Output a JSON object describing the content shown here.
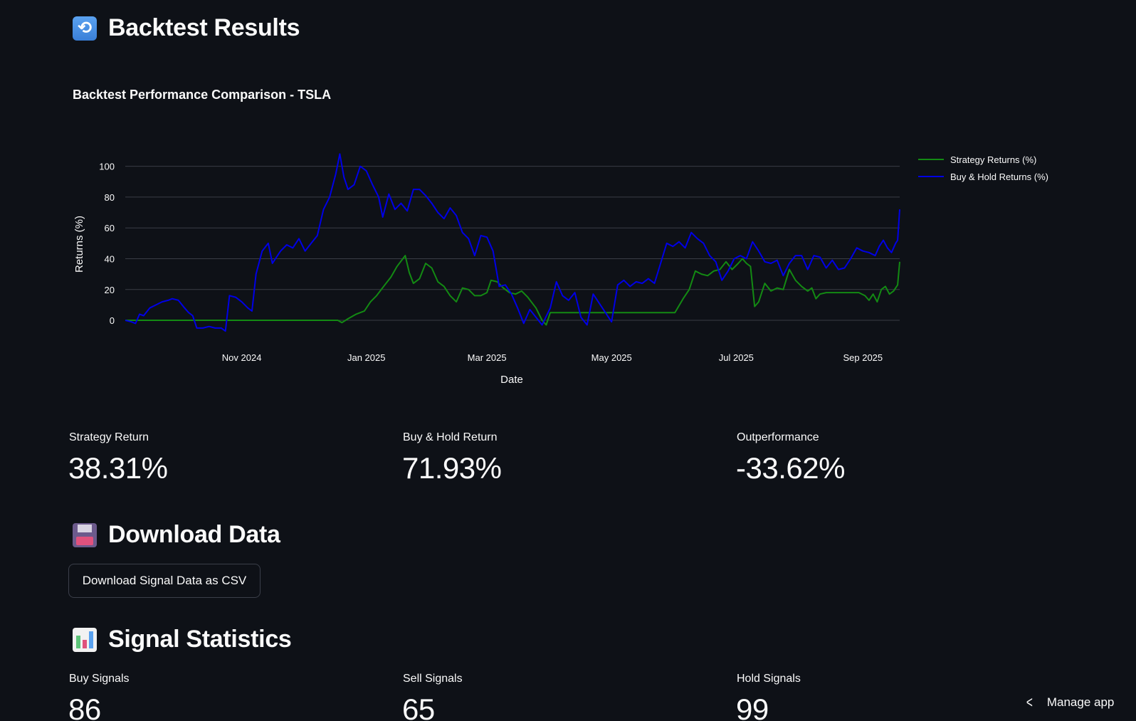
{
  "header": {
    "title": "Backtest Results",
    "icon": "refresh-icon"
  },
  "chart": {
    "title": "Backtest Performance Comparison - TSLA",
    "xlabel": "Date",
    "ylabel": "Returns (%)"
  },
  "chart_data": {
    "type": "line",
    "title": "Backtest Performance Comparison - TSLA",
    "xlabel": "Date",
    "ylabel": "Returns (%)",
    "x_range": [
      "2024-09-05",
      "2025-09-19"
    ],
    "ylim": [
      -12,
      110
    ],
    "y_ticks": [
      0,
      20,
      40,
      60,
      80,
      100
    ],
    "x_ticks": [
      {
        "date": "2024-11-01",
        "label": "Nov 2024"
      },
      {
        "date": "2025-01-01",
        "label": "Jan 2025"
      },
      {
        "date": "2025-03-01",
        "label": "Mar 2025"
      },
      {
        "date": "2025-05-01",
        "label": "May 2025"
      },
      {
        "date": "2025-07-01",
        "label": "Jul 2025"
      },
      {
        "date": "2025-09-01",
        "label": "Sep 2025"
      }
    ],
    "grid": true,
    "legend_position": "top-right",
    "series": [
      {
        "name": "Strategy Returns (%)",
        "color": "#138a13",
        "points": [
          [
            "2024-09-05",
            0
          ],
          [
            "2024-09-20",
            0
          ],
          [
            "2024-10-10",
            0
          ],
          [
            "2024-10-30",
            0
          ],
          [
            "2024-11-20",
            0
          ],
          [
            "2024-12-05",
            0
          ],
          [
            "2024-12-18",
            0
          ],
          [
            "2024-12-20",
            -1.5
          ],
          [
            "2024-12-23",
            1
          ],
          [
            "2024-12-27",
            4
          ],
          [
            "2024-12-31",
            6
          ],
          [
            "2025-01-03",
            12
          ],
          [
            "2025-01-06",
            16
          ],
          [
            "2025-01-10",
            23
          ],
          [
            "2025-01-13",
            28
          ],
          [
            "2025-01-16",
            35
          ],
          [
            "2025-01-20",
            42
          ],
          [
            "2025-01-22",
            31
          ],
          [
            "2025-01-24",
            24
          ],
          [
            "2025-01-27",
            27
          ],
          [
            "2025-01-30",
            37
          ],
          [
            "2025-02-02",
            34
          ],
          [
            "2025-02-05",
            25
          ],
          [
            "2025-02-08",
            22
          ],
          [
            "2025-02-11",
            16
          ],
          [
            "2025-02-14",
            12
          ],
          [
            "2025-02-17",
            21
          ],
          [
            "2025-02-20",
            20
          ],
          [
            "2025-02-23",
            16
          ],
          [
            "2025-02-26",
            16
          ],
          [
            "2025-03-01",
            18
          ],
          [
            "2025-03-03",
            26
          ],
          [
            "2025-03-06",
            25
          ],
          [
            "2025-03-09",
            21
          ],
          [
            "2025-03-12",
            18
          ],
          [
            "2025-03-15",
            17
          ],
          [
            "2025-03-18",
            19
          ],
          [
            "2025-03-21",
            15
          ],
          [
            "2025-03-25",
            8
          ],
          [
            "2025-03-28",
            0
          ],
          [
            "2025-03-30",
            -3
          ],
          [
            "2025-04-01",
            5
          ],
          [
            "2025-04-10",
            5
          ],
          [
            "2025-04-25",
            5
          ],
          [
            "2025-05-10",
            5
          ],
          [
            "2025-05-25",
            5
          ],
          [
            "2025-06-01",
            5
          ],
          [
            "2025-06-05",
            14
          ],
          [
            "2025-06-08",
            20
          ],
          [
            "2025-06-11",
            32
          ],
          [
            "2025-06-14",
            30
          ],
          [
            "2025-06-17",
            29
          ],
          [
            "2025-06-20",
            32
          ],
          [
            "2025-06-23",
            33
          ],
          [
            "2025-06-26",
            38
          ],
          [
            "2025-06-29",
            33
          ],
          [
            "2025-07-02",
            37
          ],
          [
            "2025-07-04",
            40
          ],
          [
            "2025-07-06",
            37
          ],
          [
            "2025-07-08",
            35
          ],
          [
            "2025-07-10",
            9
          ],
          [
            "2025-07-12",
            12
          ],
          [
            "2025-07-15",
            24
          ],
          [
            "2025-07-18",
            19
          ],
          [
            "2025-07-21",
            21
          ],
          [
            "2025-07-24",
            20
          ],
          [
            "2025-07-27",
            33
          ],
          [
            "2025-07-30",
            26
          ],
          [
            "2025-08-02",
            22
          ],
          [
            "2025-08-05",
            19
          ],
          [
            "2025-08-07",
            21
          ],
          [
            "2025-08-09",
            14
          ],
          [
            "2025-08-11",
            17
          ],
          [
            "2025-08-14",
            18
          ],
          [
            "2025-08-20",
            18
          ],
          [
            "2025-08-30",
            18
          ],
          [
            "2025-09-02",
            16
          ],
          [
            "2025-09-04",
            13
          ],
          [
            "2025-09-06",
            17
          ],
          [
            "2025-09-08",
            12
          ],
          [
            "2025-09-10",
            20
          ],
          [
            "2025-09-12",
            22
          ],
          [
            "2025-09-14",
            17
          ],
          [
            "2025-09-16",
            19
          ],
          [
            "2025-09-18",
            23
          ],
          [
            "2025-09-19",
            38
          ]
        ]
      },
      {
        "name": "Buy & Hold Returns (%)",
        "color": "#0000e6",
        "points": [
          [
            "2024-09-05",
            0
          ],
          [
            "2024-09-08",
            -1
          ],
          [
            "2024-09-10",
            -2
          ],
          [
            "2024-09-12",
            4
          ],
          [
            "2024-09-14",
            3
          ],
          [
            "2024-09-17",
            8
          ],
          [
            "2024-09-20",
            10
          ],
          [
            "2024-09-23",
            12
          ],
          [
            "2024-09-26",
            13
          ],
          [
            "2024-09-28",
            14
          ],
          [
            "2024-10-01",
            13
          ],
          [
            "2024-10-04",
            8
          ],
          [
            "2024-10-06",
            5
          ],
          [
            "2024-10-08",
            3
          ],
          [
            "2024-10-10",
            -5
          ],
          [
            "2024-10-13",
            -5
          ],
          [
            "2024-10-16",
            -4
          ],
          [
            "2024-10-19",
            -5
          ],
          [
            "2024-10-22",
            -5
          ],
          [
            "2024-10-24",
            -7
          ],
          [
            "2024-10-26",
            16
          ],
          [
            "2024-10-29",
            15
          ],
          [
            "2024-11-01",
            12
          ],
          [
            "2024-11-04",
            8
          ],
          [
            "2024-11-06",
            6
          ],
          [
            "2024-11-08",
            30
          ],
          [
            "2024-11-11",
            45
          ],
          [
            "2024-11-14",
            50
          ],
          [
            "2024-11-16",
            37
          ],
          [
            "2024-11-18",
            41
          ],
          [
            "2024-11-20",
            45
          ],
          [
            "2024-11-23",
            49
          ],
          [
            "2024-11-26",
            47
          ],
          [
            "2024-11-29",
            53
          ],
          [
            "2024-12-02",
            45
          ],
          [
            "2024-12-05",
            50
          ],
          [
            "2024-12-08",
            55
          ],
          [
            "2024-12-11",
            72
          ],
          [
            "2024-12-14",
            80
          ],
          [
            "2024-12-17",
            95
          ],
          [
            "2024-12-19",
            108
          ],
          [
            "2024-12-21",
            93
          ],
          [
            "2024-12-23",
            85
          ],
          [
            "2024-12-26",
            88
          ],
          [
            "2024-12-29",
            100
          ],
          [
            "2025-01-01",
            97
          ],
          [
            "2025-01-04",
            88
          ],
          [
            "2025-01-07",
            80
          ],
          [
            "2025-01-09",
            67
          ],
          [
            "2025-01-12",
            82
          ],
          [
            "2025-01-15",
            72
          ],
          [
            "2025-01-18",
            76
          ],
          [
            "2025-01-21",
            71
          ],
          [
            "2025-01-24",
            85
          ],
          [
            "2025-01-27",
            85
          ],
          [
            "2025-01-30",
            81
          ],
          [
            "2025-02-02",
            76
          ],
          [
            "2025-02-05",
            70
          ],
          [
            "2025-02-08",
            66
          ],
          [
            "2025-02-11",
            73
          ],
          [
            "2025-02-14",
            68
          ],
          [
            "2025-02-17",
            57
          ],
          [
            "2025-02-20",
            53
          ],
          [
            "2025-02-23",
            42
          ],
          [
            "2025-02-26",
            55
          ],
          [
            "2025-03-01",
            54
          ],
          [
            "2025-03-04",
            45
          ],
          [
            "2025-03-07",
            22
          ],
          [
            "2025-03-10",
            23
          ],
          [
            "2025-03-13",
            17
          ],
          [
            "2025-03-16",
            8
          ],
          [
            "2025-03-19",
            -2
          ],
          [
            "2025-03-22",
            7
          ],
          [
            "2025-03-25",
            2
          ],
          [
            "2025-03-28",
            -3
          ],
          [
            "2025-04-01",
            8
          ],
          [
            "2025-04-04",
            25
          ],
          [
            "2025-04-07",
            16
          ],
          [
            "2025-04-10",
            13
          ],
          [
            "2025-04-13",
            18
          ],
          [
            "2025-04-16",
            2
          ],
          [
            "2025-04-19",
            -3
          ],
          [
            "2025-04-22",
            17
          ],
          [
            "2025-04-25",
            11
          ],
          [
            "2025-04-28",
            5
          ],
          [
            "2025-05-01",
            -1
          ],
          [
            "2025-05-04",
            23
          ],
          [
            "2025-05-07",
            26
          ],
          [
            "2025-05-10",
            22
          ],
          [
            "2025-05-13",
            25
          ],
          [
            "2025-05-16",
            24
          ],
          [
            "2025-05-19",
            27
          ],
          [
            "2025-05-22",
            24
          ],
          [
            "2025-05-25",
            37
          ],
          [
            "2025-05-28",
            50
          ],
          [
            "2025-05-31",
            48
          ],
          [
            "2025-06-03",
            51
          ],
          [
            "2025-06-06",
            47
          ],
          [
            "2025-06-09",
            57
          ],
          [
            "2025-06-12",
            53
          ],
          [
            "2025-06-15",
            50
          ],
          [
            "2025-06-18",
            42
          ],
          [
            "2025-06-21",
            38
          ],
          [
            "2025-06-24",
            26
          ],
          [
            "2025-06-27",
            32
          ],
          [
            "2025-06-30",
            40
          ],
          [
            "2025-07-03",
            42
          ],
          [
            "2025-07-06",
            40
          ],
          [
            "2025-07-09",
            51
          ],
          [
            "2025-07-12",
            45
          ],
          [
            "2025-07-15",
            38
          ],
          [
            "2025-07-18",
            37
          ],
          [
            "2025-07-21",
            39
          ],
          [
            "2025-07-24",
            29
          ],
          [
            "2025-07-27",
            37
          ],
          [
            "2025-07-30",
            42
          ],
          [
            "2025-08-02",
            42
          ],
          [
            "2025-08-05",
            33
          ],
          [
            "2025-08-08",
            42
          ],
          [
            "2025-08-11",
            41
          ],
          [
            "2025-08-14",
            34
          ],
          [
            "2025-08-17",
            39
          ],
          [
            "2025-08-20",
            33
          ],
          [
            "2025-08-23",
            34
          ],
          [
            "2025-08-26",
            40
          ],
          [
            "2025-08-29",
            47
          ],
          [
            "2025-09-01",
            45
          ],
          [
            "2025-09-04",
            44
          ],
          [
            "2025-09-07",
            42
          ],
          [
            "2025-09-09",
            48
          ],
          [
            "2025-09-11",
            52
          ],
          [
            "2025-09-13",
            47
          ],
          [
            "2025-09-15",
            44
          ],
          [
            "2025-09-17",
            50
          ],
          [
            "2025-09-18",
            52
          ],
          [
            "2025-09-19",
            72
          ]
        ]
      }
    ]
  },
  "metrics": [
    {
      "label": "Strategy Return",
      "value": "38.31%"
    },
    {
      "label": "Buy & Hold Return",
      "value": "71.93%"
    },
    {
      "label": "Outperformance",
      "value": "-33.62%"
    }
  ],
  "download": {
    "title": "Download Data",
    "icon": "floppy-disk-icon",
    "button_label": "Download Signal Data as CSV"
  },
  "signals": {
    "title": "Signal Statistics",
    "icon": "bar-chart-icon",
    "items": [
      {
        "label": "Buy Signals",
        "value": "86"
      },
      {
        "label": "Sell Signals",
        "value": "65"
      },
      {
        "label": "Hold Signals",
        "value": "99"
      }
    ]
  },
  "manage_app": {
    "label": "Manage app",
    "icon": "chevron-left-icon"
  }
}
